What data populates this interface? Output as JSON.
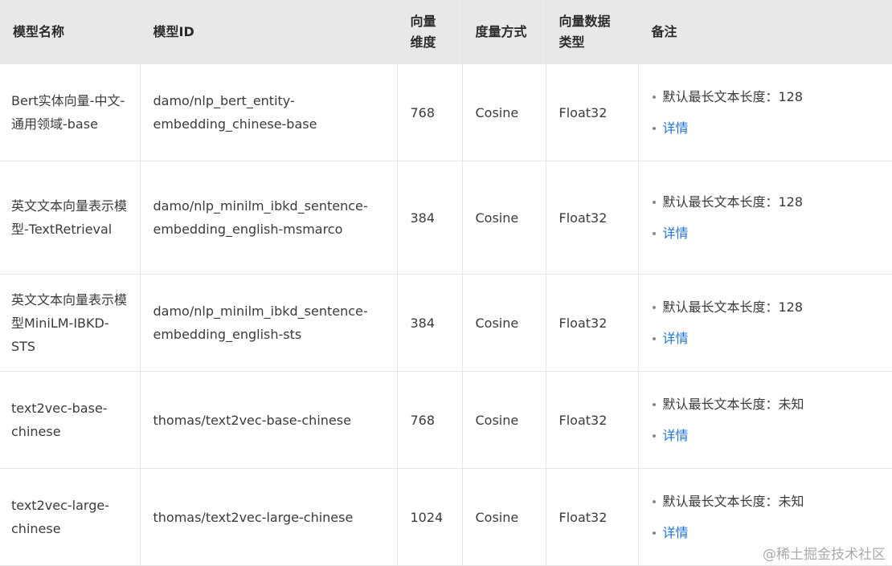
{
  "headers": [
    "模型名称",
    "模型ID",
    "向量维度",
    "度量方式",
    "向量数据类型",
    "备注"
  ],
  "rows": [
    {
      "name": "Bert实体向量-中文-通用领域-base",
      "id": "damo/nlp_bert_entity-embedding_chinese-base",
      "dim": "768",
      "metric": "Cosine",
      "dtype": "Float32",
      "note": "默认最长文本长度：128",
      "link": "详情"
    },
    {
      "name": "英文文本向量表示模型-TextRetrieval",
      "id": "damo/nlp_minilm_ibkd_sentence-embedding_english-msmarco",
      "dim": "384",
      "metric": "Cosine",
      "dtype": "Float32",
      "note": "默认最长文本长度：128",
      "link": "详情"
    },
    {
      "name": "英文文本向量表示模型MiniLM-IBKD-STS",
      "id": "damo/nlp_minilm_ibkd_sentence-embedding_english-sts",
      "dim": "384",
      "metric": "Cosine",
      "dtype": "Float32",
      "note": "默认最长文本长度：128",
      "link": "详情"
    },
    {
      "name": "text2vec-base-chinese",
      "id": "thomas/text2vec-base-chinese",
      "dim": "768",
      "metric": "Cosine",
      "dtype": "Float32",
      "note": "默认最长文本长度：未知",
      "link": "详情"
    },
    {
      "name": "text2vec-large-chinese",
      "id": "thomas/text2vec-large-chinese",
      "dim": "1024",
      "metric": "Cosine",
      "dtype": "Float32",
      "note": "默认最长文本长度：未知",
      "link": "详情"
    }
  ],
  "watermark": "@稀土掘金技术社区",
  "colors": {
    "header_bg": "#e8e8e8",
    "link": "#1e73d6",
    "border": "#e6e6e6"
  }
}
